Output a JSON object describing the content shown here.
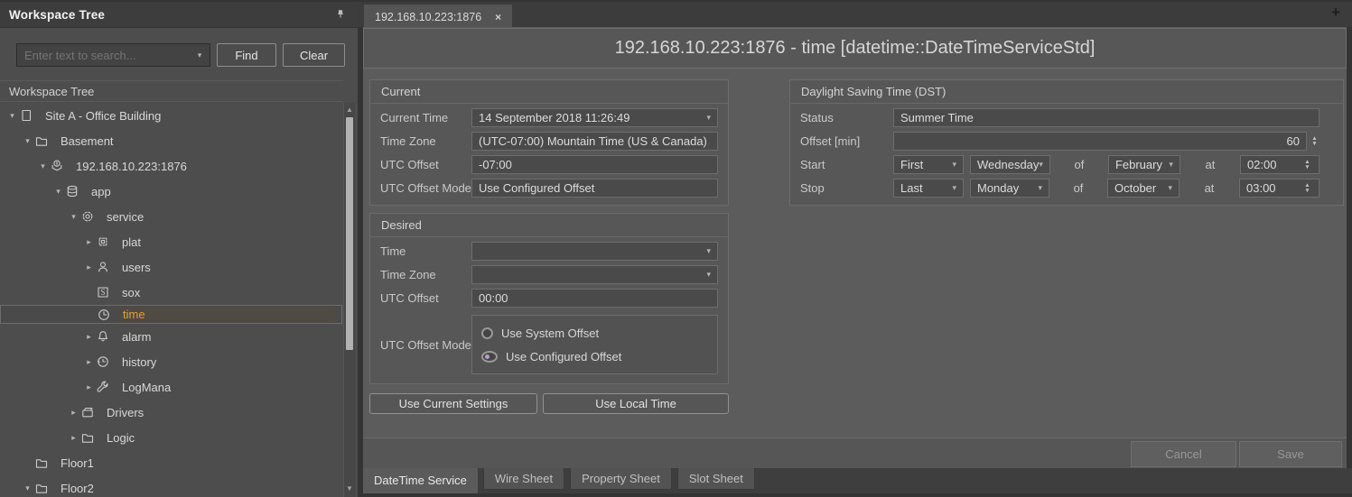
{
  "colors": {
    "selected_tree_text": "#e2a03c",
    "selected_tree_bg": "#4f4a44",
    "radio_selected_dot": "#b79fce",
    "panel_bg": "#5c5c5c",
    "field_bg": "#4a4a4a"
  },
  "left_panel": {
    "title": "Workspace Tree",
    "search": {
      "placeholder": "Enter text to search...",
      "find_label": "Find",
      "clear_label": "Clear"
    },
    "section_title": "Workspace Tree",
    "tree": [
      {
        "label": "Site A - Office Building",
        "icon": "page-icon",
        "level": 0,
        "expanded": true,
        "selected": false
      },
      {
        "label": "Basement",
        "icon": "folder-icon",
        "level": 1,
        "expanded": true,
        "selected": false
      },
      {
        "label": "192.168.10.223:1876",
        "icon": "device-icon",
        "level": 2,
        "expanded": true,
        "selected": false
      },
      {
        "label": "app",
        "icon": "database-icon",
        "level": 3,
        "expanded": true,
        "selected": false
      },
      {
        "label": "service",
        "icon": "gear-icon",
        "level": 4,
        "expanded": true,
        "selected": false
      },
      {
        "label": "plat",
        "icon": "chip-icon",
        "level": 5,
        "expanded": false,
        "selected": false
      },
      {
        "label": "users",
        "icon": "user-icon",
        "level": 5,
        "expanded": false,
        "selected": false
      },
      {
        "label": "sox",
        "icon": "sox-icon",
        "level": 5,
        "expanded": null,
        "selected": false
      },
      {
        "label": "time",
        "icon": "clock-icon",
        "level": 5,
        "expanded": null,
        "selected": true
      },
      {
        "label": "alarm",
        "icon": "bell-icon",
        "level": 5,
        "expanded": false,
        "selected": false
      },
      {
        "label": "history",
        "icon": "history-icon",
        "level": 5,
        "expanded": false,
        "selected": false
      },
      {
        "label": "LogMana",
        "icon": "wrench-icon",
        "level": 5,
        "expanded": false,
        "selected": false
      },
      {
        "label": "Drivers",
        "icon": "drivers-icon",
        "level": 4,
        "expanded": false,
        "selected": false
      },
      {
        "label": "Logic",
        "icon": "folder-icon",
        "level": 4,
        "expanded": false,
        "selected": false
      },
      {
        "label": "Floor1",
        "icon": "folder-icon",
        "level": 1,
        "expanded": null,
        "selected": false
      },
      {
        "label": "Floor2",
        "icon": "folder-icon",
        "level": 1,
        "expanded": true,
        "selected": false
      }
    ]
  },
  "main": {
    "tab": {
      "label": "192.168.10.223:1876",
      "close_icon": "×"
    },
    "new_tab_icon": "+",
    "title": "192.168.10.223:1876 - time [datetime::DateTimeServiceStd]",
    "current_group": {
      "title": "Current",
      "fields": {
        "current_time": {
          "label": "Current Time",
          "value": "14 September 2018 11:26:49"
        },
        "time_zone": {
          "label": "Time Zone",
          "value": "(UTC-07:00) Mountain Time (US & Canada)"
        },
        "utc_offset": {
          "label": "UTC Offset",
          "value": "-07:00"
        },
        "utc_offset_mode": {
          "label": "UTC Offset Mode",
          "value": "Use Configured Offset"
        }
      }
    },
    "dst_group": {
      "title": "Daylight Saving Time (DST)",
      "fields": {
        "status": {
          "label": "Status",
          "value": "Summer Time"
        },
        "offset_min": {
          "label": "Offset [min]",
          "value": "60"
        },
        "start": {
          "label": "Start",
          "ordinal": "First",
          "weekday": "Wednesday",
          "of": "of",
          "month": "February",
          "at": "at",
          "time": "02:00"
        },
        "stop": {
          "label": "Stop",
          "ordinal": "Last",
          "weekday": "Monday",
          "of": "of",
          "month": "October",
          "at": "at",
          "time": "03:00"
        }
      }
    },
    "desired_group": {
      "title": "Desired",
      "fields": {
        "time": {
          "label": "Time",
          "value": ""
        },
        "time_zone": {
          "label": "Time Zone",
          "value": ""
        },
        "utc_offset": {
          "label": "UTC Offset",
          "value": "00:00"
        },
        "utc_offset_mode": {
          "label": "UTC Offset Mode"
        }
      },
      "radio_options": [
        {
          "label": "Use System Offset",
          "selected": false
        },
        {
          "label": "Use Configured Offset",
          "selected": true
        }
      ]
    },
    "action_buttons": {
      "use_current": "Use Current Settings",
      "use_local": "Use Local Time"
    },
    "footer_buttons": {
      "cancel": "Cancel",
      "save": "Save"
    },
    "bottom_tabs": [
      {
        "label": "DateTime Service",
        "active": true
      },
      {
        "label": "Wire Sheet",
        "active": false
      },
      {
        "label": "Property Sheet",
        "active": false
      },
      {
        "label": "Slot Sheet",
        "active": false
      }
    ]
  }
}
